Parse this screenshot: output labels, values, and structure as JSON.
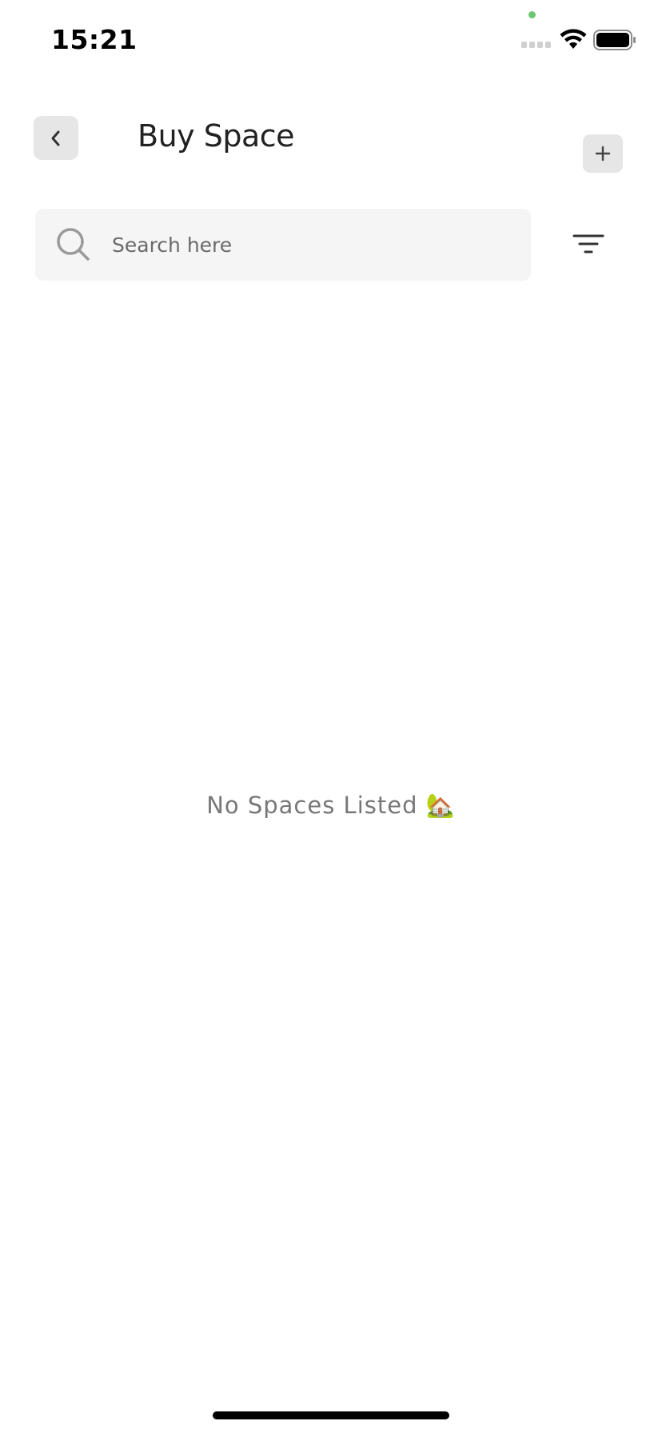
{
  "status_bar": {
    "time": "15:21"
  },
  "header": {
    "title": "Buy Space",
    "back_icon": "chevron-left-icon",
    "add_icon": "plus-icon"
  },
  "search": {
    "placeholder": "Search here",
    "value": "",
    "icon": "search-icon"
  },
  "filter": {
    "icon": "filter-icon"
  },
  "empty_state": {
    "message": "No Spaces Listed 🏡"
  },
  "colors": {
    "background": "#ffffff",
    "button_bg": "#e6e6e6",
    "search_bg": "#f5f5f5",
    "text_primary": "#222222",
    "text_muted": "#777777",
    "mic_indicator": "#6cc774"
  }
}
